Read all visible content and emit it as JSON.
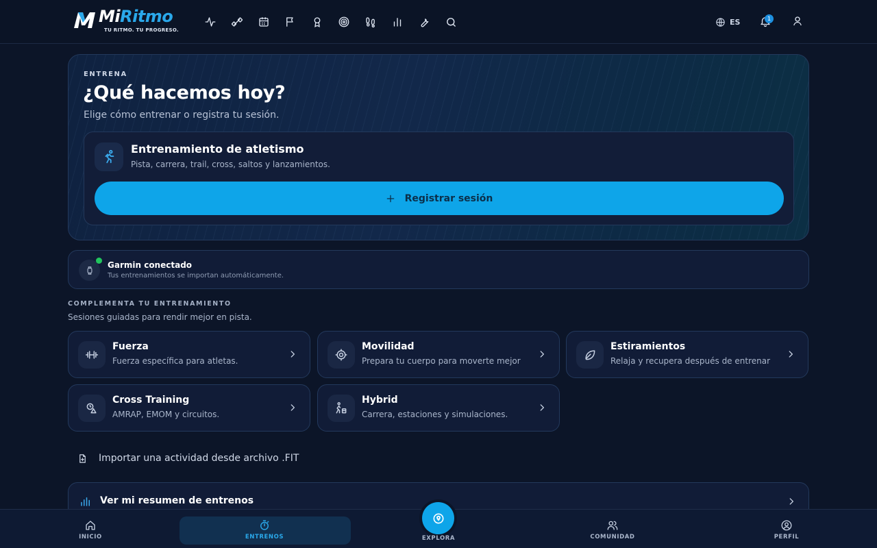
{
  "brand": {
    "name_prefix": "Mi",
    "name_suffix": "Ritmo",
    "tagline": "TU RITMO. TU PROGRESO.",
    "accent_color": "#2aa8ea"
  },
  "topnav": {
    "icons": [
      "activity-icon",
      "dumbbell-icon",
      "calendar-icon",
      "flag-icon",
      "medal-icon",
      "target-icon",
      "footprints-icon",
      "bar-chart-icon",
      "wrench-icon",
      "search-icon"
    ],
    "language": "ES",
    "notifications_count": "1"
  },
  "hero": {
    "eyebrow": "ENTRENA",
    "title": "¿Qué hacemos hoy?",
    "subtitle": "Elige cómo entrenar o registra tu sesión.",
    "card": {
      "title": "Entrenamiento de atletismo",
      "subtitle": "Pista, carrera, trail, cross, saltos y lanzamientos.",
      "button_label": "Registrar sesión"
    }
  },
  "garmin": {
    "title": "Garmin conectado",
    "subtitle": "Tus entrenamientos se importan automáticamente.",
    "status_color": "#22c55e"
  },
  "complement": {
    "eyebrow": "COMPLEMENTA TU ENTRENAMIENTO",
    "subtitle": "Sesiones guiadas para rendir mejor en pista.",
    "tiles": [
      {
        "title": "Fuerza",
        "subtitle": "Fuerza específica para atletas.",
        "icon": "dumbbell-icon"
      },
      {
        "title": "Movilidad",
        "subtitle": "Prepara tu cuerpo para moverte mejor",
        "icon": "crosshair-icon"
      },
      {
        "title": "Estiramientos",
        "subtitle": "Relaja y recupera después de entrenar",
        "icon": "leaf-icon"
      },
      {
        "title": "Cross Training",
        "subtitle": "AMRAP, EMOM y circuitos.",
        "icon": "shapes-icon"
      },
      {
        "title": "Hybrid",
        "subtitle": "Carrera, estaciones y simulaciones.",
        "icon": "runner-station-icon"
      }
    ]
  },
  "import_label": "Importar una actividad desde archivo .FIT",
  "summary_label": "Ver mi resumen de entrenos",
  "bottomnav": {
    "items": [
      {
        "label": "INICIO",
        "icon": "home-icon"
      },
      {
        "label": "ENTRENOS",
        "icon": "stopwatch-icon"
      },
      {
        "label": "EXPLORA",
        "icon": "map-pin-icon"
      },
      {
        "label": "COMUNIDAD",
        "icon": "users-icon"
      },
      {
        "label": "PERFIL",
        "icon": "user-circle-icon"
      }
    ],
    "active_color": "#2aa8ea"
  }
}
